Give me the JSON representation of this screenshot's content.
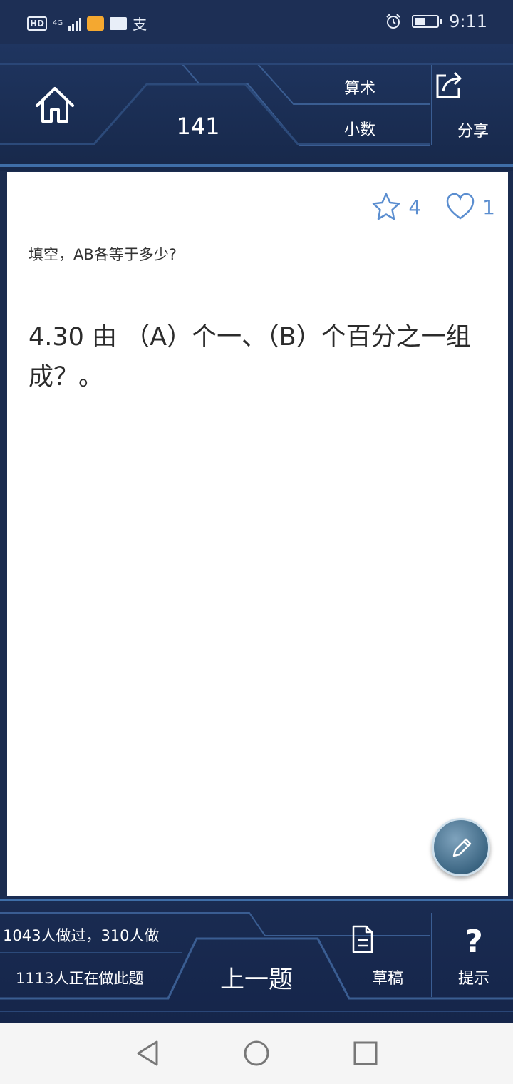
{
  "status_bar": {
    "hd_badge": "HD",
    "network": "4G",
    "alipay_glyph": "支",
    "time": "9:11",
    "icons": [
      "hd-icon",
      "signal-icon",
      "message-icon",
      "mail-icon",
      "alipay-icon",
      "alarm-icon",
      "battery-icon"
    ]
  },
  "header": {
    "home_icon": "home-icon",
    "question_number": "141",
    "category_primary": "算术",
    "category_secondary": "小数",
    "share_label": "分享",
    "share_icon": "share-icon"
  },
  "question_card": {
    "favorites_count": "4",
    "likes_count": "1",
    "prompt": "填空，AB各等于多少?",
    "question_text": "4.30 由 （A）个一、（B）个百分之一组成？。",
    "edit_icon": "pencil-icon"
  },
  "footer": {
    "done_count_text": "1043人做过，310人做",
    "doing_count_text": "1113人正在做此题",
    "prev_label": "上一题",
    "draft_label": "草稿",
    "hint_label": "提示",
    "hint_glyph": "?"
  },
  "system_nav": {
    "icons": [
      "back-icon",
      "home-circle-icon",
      "recents-icon"
    ]
  },
  "colors": {
    "frame_blue": "#1b2c4f",
    "accent_line": "#3f6ea8",
    "stat_blue": "#5b8ed0"
  }
}
